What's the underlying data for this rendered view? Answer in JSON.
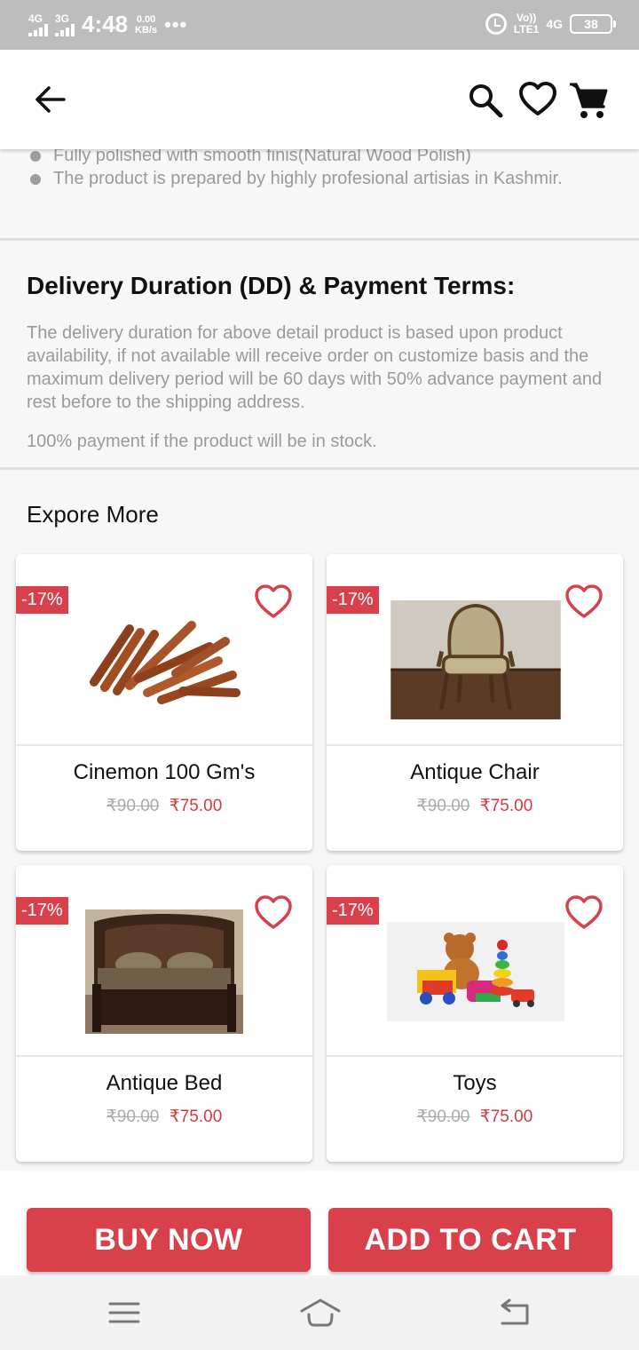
{
  "status_bar": {
    "net1": "4G",
    "net2": "3G",
    "time": "4:48",
    "speed_value": "0.00",
    "speed_unit": "KB/s",
    "more": "•••",
    "volte": "Vo))",
    "lte": "LTE1",
    "net3": "4G",
    "battery": "38"
  },
  "header": {
    "icons": [
      "back-arrow-icon",
      "search-icon",
      "heart-outline-icon",
      "cart-icon"
    ]
  },
  "product_details": {
    "bullets": [
      "Fully polished with smooth finis(Natural Wood Polish)",
      "The product is prepared by highly profesional artisias in Kashmir."
    ]
  },
  "delivery": {
    "title": "Delivery Duration (DD) & Payment Terms:",
    "body": "The delivery duration for above detail product is based upon product availability, if not available will receive order on customize basis and the maximum delivery period will be 60 days with 50% advance payment and rest before to the shipping address.",
    "note": "100% payment if the product will be in stock."
  },
  "explore": {
    "title": "Expore More",
    "products": [
      {
        "name": "Cinemon 100 Gm's",
        "discount": "-17%",
        "old_price": "₹90.00",
        "new_price": "₹75.00",
        "image": "cinnamon-sticks"
      },
      {
        "name": "Antique Chair",
        "discount": "-17%",
        "old_price": "₹90.00",
        "new_price": "₹75.00",
        "image": "antique-chair"
      },
      {
        "name": "Antique Bed",
        "discount": "-17%",
        "old_price": "₹90.00",
        "new_price": "₹75.00",
        "image": "antique-bed"
      },
      {
        "name": "Toys",
        "discount": "-17%",
        "old_price": "₹90.00",
        "new_price": "₹75.00",
        "image": "toys"
      }
    ]
  },
  "actions": {
    "buy_now": "BUY NOW",
    "add_to_cart": "ADD TO CART"
  },
  "colors": {
    "accent": "#d8404c",
    "price": "#d23a45",
    "status_bar": "#bdbdbd"
  }
}
